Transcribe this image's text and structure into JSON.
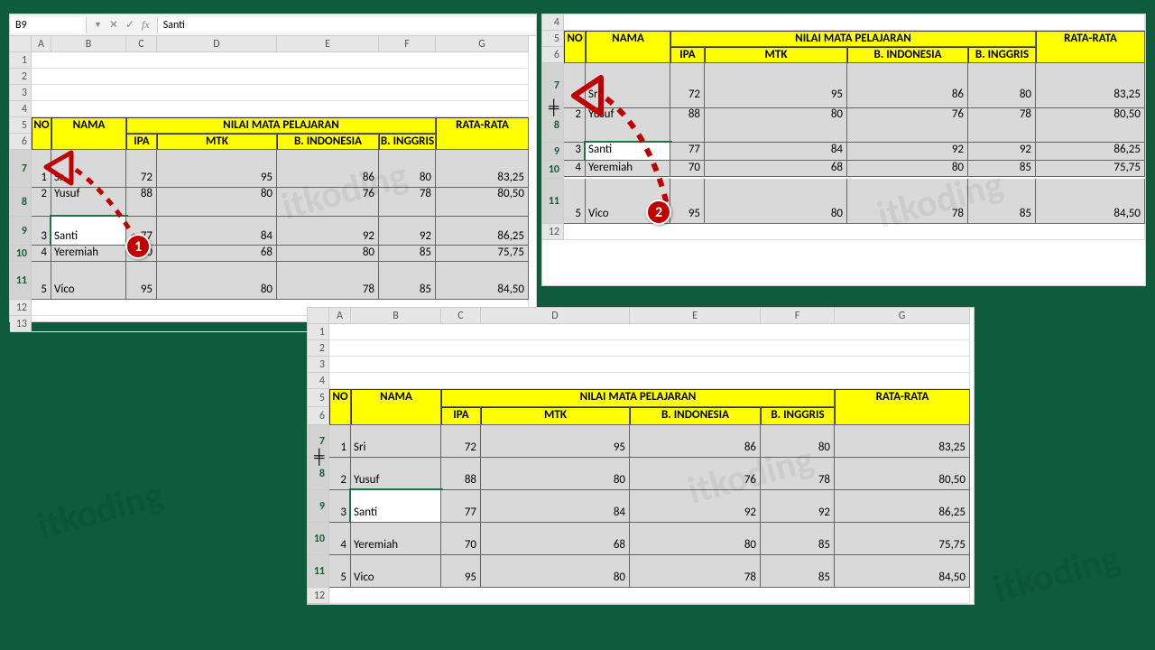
{
  "formula_bar": {
    "cell_ref": "B9",
    "cancel": "✕",
    "enter": "✓",
    "fx": "fx",
    "value": "Santi"
  },
  "headers": {
    "no": "NO",
    "nama": "NAMA",
    "group": "NILAI MATA PELAJARAN",
    "ipa": "IPA",
    "mtk": "MTK",
    "bindo": "B. INDONESIA",
    "bing": "B. INGGRIS",
    "rata": "RATA-RATA"
  },
  "rows": [
    {
      "no": "1",
      "nama": "Sri",
      "ipa": "72",
      "mtk": "95",
      "bindo": "86",
      "bing": "80",
      "rata": "83,25"
    },
    {
      "no": "2",
      "nama": "Yusuf",
      "ipa": "88",
      "mtk": "80",
      "bindo": "76",
      "bing": "78",
      "rata": "80,50"
    },
    {
      "no": "3",
      "nama": "Santi",
      "ipa": "77",
      "mtk": "84",
      "bindo": "92",
      "bing": "92",
      "rata": "86,25"
    },
    {
      "no": "4",
      "nama": "Yeremiah",
      "ipa": "70",
      "mtk": "68",
      "bindo": "80",
      "bing": "85",
      "rata": "75,75"
    },
    {
      "no": "5",
      "nama": "Vico",
      "ipa": "95",
      "mtk": "80",
      "bindo": "78",
      "bing": "85",
      "rata": "84,50"
    }
  ],
  "cols": [
    "A",
    "B",
    "C",
    "D",
    "E",
    "F",
    "G"
  ],
  "rownums": [
    "1",
    "2",
    "3",
    "4",
    "5",
    "6",
    "7",
    "8",
    "9",
    "10",
    "11",
    "12",
    "13"
  ],
  "callouts": {
    "one": "1",
    "two": "2"
  },
  "watermark": "itkoding"
}
